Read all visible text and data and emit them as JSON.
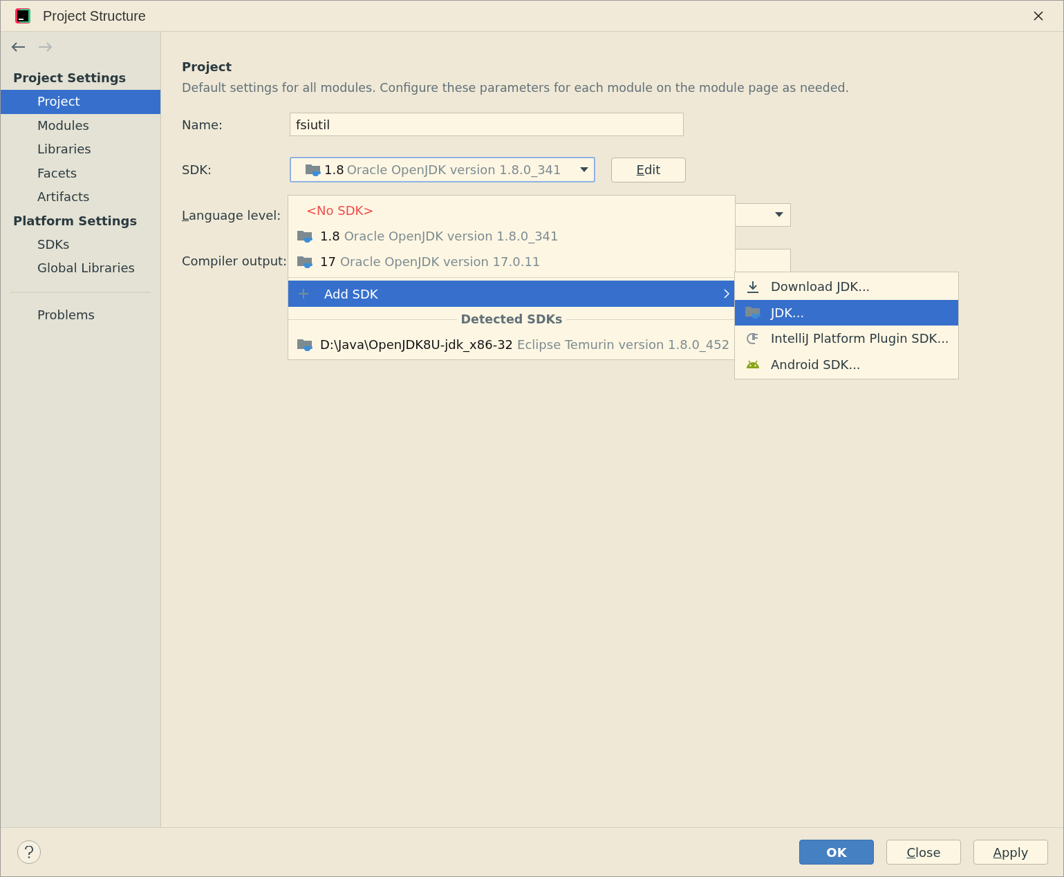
{
  "window": {
    "title": "Project Structure"
  },
  "sidebar": {
    "sections": [
      {
        "heading": "Project Settings",
        "items": [
          {
            "label": "Project",
            "selected": true
          },
          {
            "label": "Modules",
            "selected": false
          },
          {
            "label": "Libraries",
            "selected": false
          },
          {
            "label": "Facets",
            "selected": false
          },
          {
            "label": "Artifacts",
            "selected": false
          }
        ]
      },
      {
        "heading": "Platform Settings",
        "items": [
          {
            "label": "SDKs",
            "selected": false
          },
          {
            "label": "Global Libraries",
            "selected": false
          }
        ]
      }
    ],
    "extra_items": [
      {
        "label": "Problems",
        "selected": false
      }
    ]
  },
  "project": {
    "heading": "Project",
    "description": "Default settings for all modules. Configure these parameters for each module on the module page as needed.",
    "name_label": "Name:",
    "name_value": "fsiutil",
    "sdk_label": "SDK:",
    "sdk_value": {
      "version": "1.8",
      "description": "Oracle OpenJDK version 1.8.0_341"
    },
    "edit_button": "Edit",
    "language_level_label": "Language level:",
    "compiler_output_label": "Compiler output:"
  },
  "sdk_popup": {
    "items": [
      {
        "kind": "none",
        "label": "<No SDK>",
        "selected": false
      },
      {
        "kind": "jdk",
        "version": "1.8",
        "description": "Oracle OpenJDK version 1.8.0_341",
        "selected": false
      },
      {
        "kind": "jdk",
        "version": "17",
        "description": "Oracle OpenJDK version 17.0.11",
        "selected": false
      },
      {
        "kind": "submenu",
        "label": "Add SDK",
        "selected": true
      }
    ],
    "section_heading": "Detected SDKs",
    "detected": [
      {
        "path": "D:\\Java\\OpenJDK8U-jdk_x86-32",
        "description": "Eclipse Temurin version 1.8.0_452"
      }
    ]
  },
  "add_sdk_menu": {
    "items": [
      {
        "kind": "download",
        "label": "Download JDK...",
        "selected": false
      },
      {
        "kind": "jdk",
        "label": "JDK...",
        "selected": true
      },
      {
        "kind": "plugin",
        "label": "IntelliJ Platform Plugin SDK...",
        "selected": false
      },
      {
        "kind": "android",
        "label": "Android SDK...",
        "selected": false
      }
    ]
  },
  "footer": {
    "buttons": [
      {
        "label": "OK",
        "kind": "primary"
      },
      {
        "label": "Close",
        "kind": "normal"
      },
      {
        "label": "Apply",
        "kind": "normal"
      }
    ]
  }
}
